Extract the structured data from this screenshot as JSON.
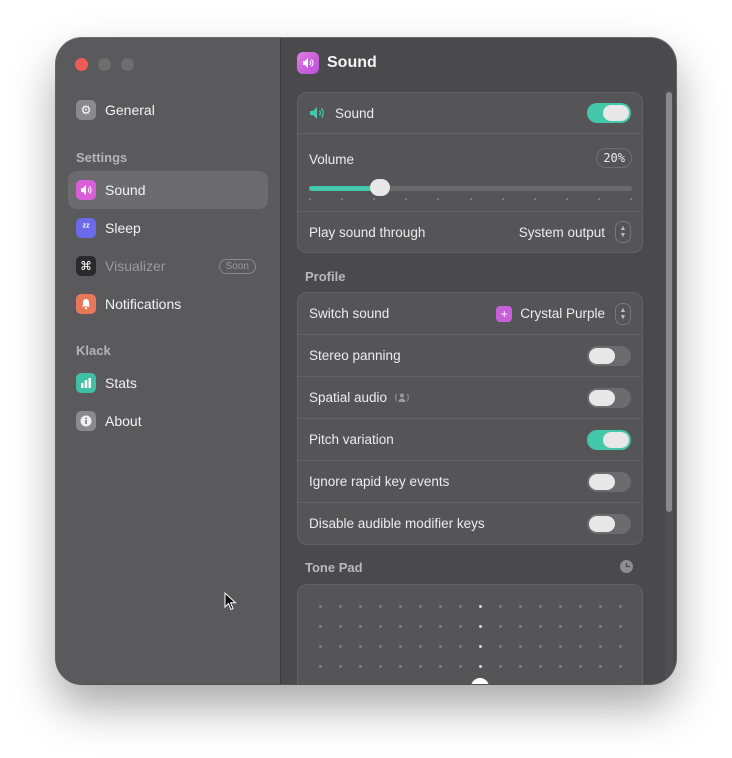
{
  "sidebar": {
    "general": "General",
    "section_settings": "Settings",
    "items_settings": [
      {
        "label": "Sound",
        "icon": "speaker-icon",
        "color": "#d95fd9"
      },
      {
        "label": "Sleep",
        "icon": "zzz-icon",
        "color": "#6b6bea"
      },
      {
        "label": "Visualizer",
        "icon": "command-icon",
        "badge": "Soon"
      },
      {
        "label": "Notifications",
        "icon": "bell-icon",
        "color": "#e8775a"
      }
    ],
    "section_klack": "Klack",
    "items_klack": [
      {
        "label": "Stats",
        "icon": "bar-chart-icon",
        "color": "#3fbfa4"
      },
      {
        "label": "About",
        "icon": "info-icon"
      }
    ]
  },
  "header": {
    "title": "Sound"
  },
  "sound_group": {
    "sound_label": "Sound",
    "sound_on": true,
    "volume_label": "Volume",
    "volume_value": "20%",
    "volume_level": 0.22,
    "output_label": "Play sound through",
    "output_value": "System output"
  },
  "profile": {
    "title": "Profile",
    "switch_label": "Switch sound",
    "switch_value": "Crystal Purple",
    "stereo": "Stereo panning",
    "spatial": "Spatial audio",
    "pitch": "Pitch variation",
    "ignore": "Ignore rapid key events",
    "disable": "Disable audible modifier keys"
  },
  "tonepad": {
    "title": "Tone Pad"
  },
  "colors": {
    "accent": "#45c7ac",
    "close": "#ee5b56"
  }
}
